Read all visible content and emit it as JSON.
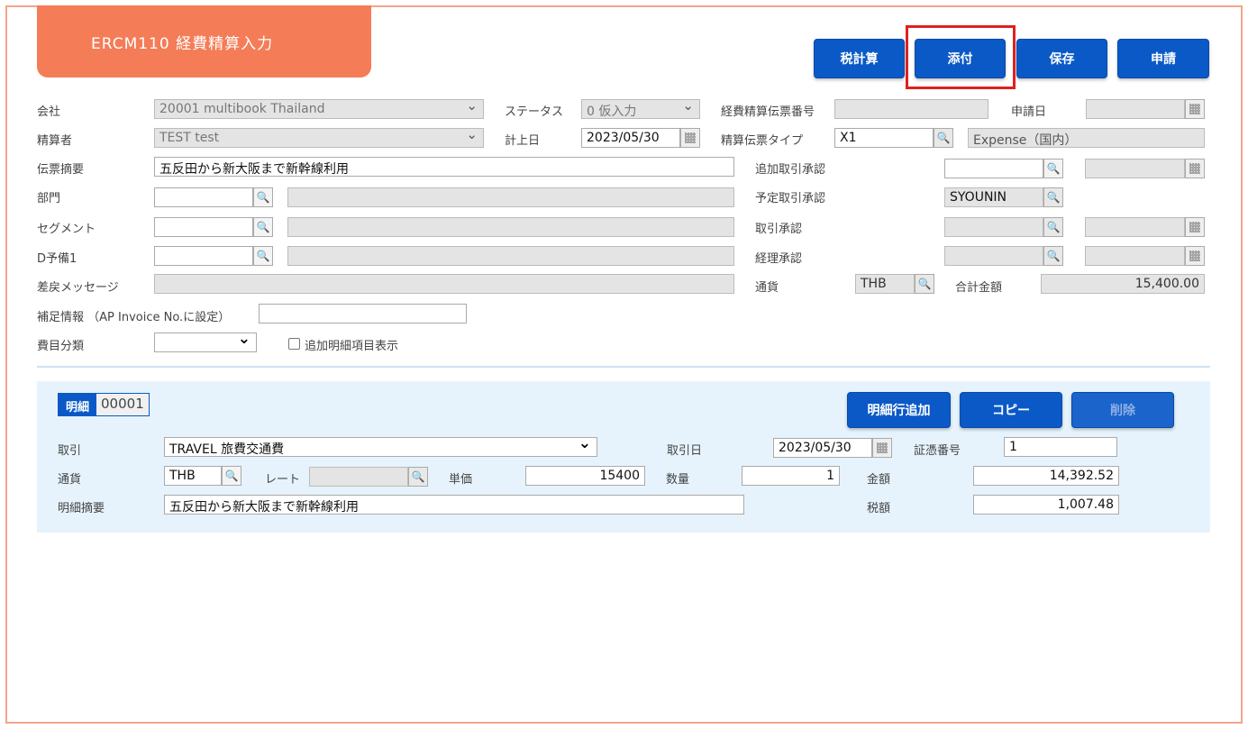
{
  "screen": {
    "title": "ERCM110 経費精算入力"
  },
  "toolbar": {
    "tax_calc": "税計算",
    "attach": "添付",
    "save": "保存",
    "apply": "申請"
  },
  "header": {
    "company_label": "会社",
    "company_value": "20001 multibook Thailand",
    "status_label": "ステータス",
    "status_value": "0 仮入力",
    "slip_no_label": "経費精算伝票番号",
    "slip_no_value": "",
    "apply_date_label": "申請日",
    "apply_date_value": "",
    "settler_label": "精算者",
    "settler_value": "TEST test",
    "posting_date_label": "計上日",
    "posting_date_value": "2023/05/30",
    "slip_type_label": "精算伝票タイプ",
    "slip_type_code": "X1",
    "slip_type_name": "Expense（国内）",
    "summary_label": "伝票摘要",
    "summary_value": "五反田から新大阪まで新幹線利用",
    "add_approval_label": "追加取引承認",
    "add_approval_value": "",
    "add_approval_date": "",
    "dept_label": "部門",
    "dept_code": "",
    "dept_name": "",
    "planned_approval_label": "予定取引承認",
    "planned_approval_value": "SYOUNIN",
    "segment_label": "セグメント",
    "segment_code": "",
    "segment_name": "",
    "trade_approval_label": "取引承認",
    "trade_approval_value": "",
    "trade_approval_date": "",
    "d_reserve_label": "D予備1",
    "d_reserve_code": "",
    "d_reserve_name": "",
    "accounting_approval_label": "経理承認",
    "accounting_approval_value": "",
    "accounting_approval_date": "",
    "reject_msg_label": "差戻メッセージ",
    "reject_msg_value": "",
    "currency_label": "通貨",
    "currency_value": "THB",
    "total_label": "合計金額",
    "total_value": "15,400.00",
    "supplement_label": "補足情報 （AP Invoice No.に設定）",
    "supplement_value": "",
    "expense_class_label": "費目分類",
    "expense_class_value": "",
    "show_extra_label": "追加明細項目表示"
  },
  "detail": {
    "badge_label": "明細",
    "badge_no": "00001",
    "add_row": "明細行追加",
    "copy": "コピー",
    "delete": "削除",
    "trade_label": "取引",
    "trade_value": "TRAVEL 旅費交通費",
    "trade_date_label": "取引日",
    "trade_date_value": "2023/05/30",
    "voucher_label": "証憑番号",
    "voucher_value": "1",
    "currency_label": "通貨",
    "currency_value": "THB",
    "rate_label": "レート",
    "rate_value": "",
    "unit_price_label": "単価",
    "unit_price_value": "15400",
    "qty_label": "数量",
    "qty_value": "1",
    "amount_label": "金額",
    "amount_value": "14,392.52",
    "desc_label": "明細摘要",
    "desc_value": "五反田から新大阪まで新幹線利用",
    "tax_label": "税額",
    "tax_value": "1,007.48"
  }
}
